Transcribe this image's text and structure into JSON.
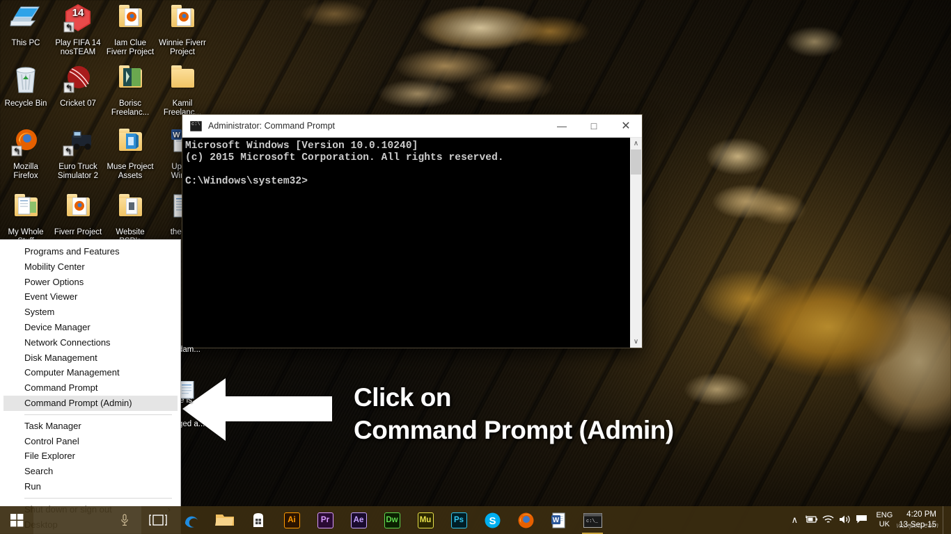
{
  "desktop": {
    "icons": [
      {
        "label": "This PC",
        "art": "monitor",
        "col": 0,
        "row": 0
      },
      {
        "label": "Play FIFA 14\nnosTEAM",
        "art": "fifa",
        "col": 1,
        "row": 0
      },
      {
        "label": "Iam Clue\nFiverr Project",
        "art": "folder-firefox",
        "col": 2,
        "row": 0
      },
      {
        "label": "Winnie Fiverr\nProject",
        "art": "folder-firefox",
        "col": 3,
        "row": 0
      },
      {
        "label": "Recycle Bin",
        "art": "recycle",
        "col": 0,
        "row": 1
      },
      {
        "label": "Cricket 07",
        "art": "cricket",
        "col": 1,
        "row": 1
      },
      {
        "label": "Borisc\nFreelanc...",
        "art": "folder-green",
        "col": 2,
        "row": 1
      },
      {
        "label": "Kamil\nFreelanc...",
        "art": "folder",
        "col": 3,
        "row": 1
      },
      {
        "label": "Mozilla\nFirefox",
        "art": "firefox",
        "col": 0,
        "row": 2
      },
      {
        "label": "Euro Truck\nSimulator 2",
        "art": "truck",
        "col": 1,
        "row": 2
      },
      {
        "label": "Muse Project\nAssets",
        "art": "folder-muse",
        "col": 2,
        "row": 2
      },
      {
        "label": "Upgra\nWindo",
        "art": "word-doc",
        "col": 3,
        "row": 2
      },
      {
        "label": "My Whole\nStuff",
        "art": "folder-docs",
        "col": 0,
        "row": 3
      },
      {
        "label": "Fiverr Project",
        "art": "folder-firefox",
        "col": 1,
        "row": 3
      },
      {
        "label": "Website\nPSD's",
        "art": "folder-ps",
        "col": 2,
        "row": 3
      },
      {
        "label": "the-file",
        "art": "text-doc",
        "col": 3,
        "row": 3
      }
    ],
    "hidden_icon_labels": [
      "dam...",
      "e is",
      "ged a..."
    ]
  },
  "cmd_window": {
    "title": "Administrator: Command Prompt",
    "icon": "cmd-icon",
    "minimize": "—",
    "maximize": "□",
    "close": "✕",
    "scroll_up": "∧",
    "scroll_down": "∨",
    "content": "Microsoft Windows [Version 10.0.10240]\n(c) 2015 Microsoft Corporation. All rights reserved.\n\nC:\\Windows\\system32>"
  },
  "winx_menu": {
    "selected": "Command Prompt (Admin)",
    "groups": [
      {
        "items": [
          "Programs and Features",
          "Mobility Center",
          "Power Options",
          "Event Viewer",
          "System",
          "Device Manager",
          "Network Connections",
          "Disk Management",
          "Computer Management",
          "Command Prompt",
          "Command Prompt (Admin)"
        ]
      },
      {
        "items": [
          "Task Manager",
          "Control Panel",
          "File Explorer",
          "Search",
          "Run"
        ]
      },
      {
        "items": [
          "Shut down or sign out",
          "Desktop"
        ]
      }
    ],
    "submenu_indicator": "›"
  },
  "callout": {
    "line1": "Click on",
    "line2": "Command Prompt (Admin)",
    "arrow_direction": "left",
    "color": "#ffffff"
  },
  "taskbar": {
    "background": "#3a2c10",
    "start_icon": "windows-logo",
    "search_placeholder": "",
    "mic_icon": "microphone-icon",
    "task_view_icon": "task-view-icon",
    "pinned": [
      {
        "name": "edge",
        "glyph": "e",
        "color": "#1f8ce0",
        "kind": "glyph"
      },
      {
        "name": "explorer",
        "glyph": "",
        "color": "#f7c873",
        "kind": "folder"
      },
      {
        "name": "store",
        "glyph": "",
        "color": "#ffffff",
        "kind": "store"
      },
      {
        "name": "illustrator",
        "glyph": "Ai",
        "color": "#ff9a00",
        "kind": "adobe",
        "bg": "#2b1400"
      },
      {
        "name": "premiere",
        "glyph": "Pr",
        "color": "#d99cff",
        "kind": "adobe",
        "bg": "#2a0a33"
      },
      {
        "name": "aftereffects",
        "glyph": "Ae",
        "color": "#c5a3ff",
        "kind": "adobe",
        "bg": "#1a0b2e"
      },
      {
        "name": "dreamweaver",
        "glyph": "Dw",
        "color": "#5fd94f",
        "kind": "adobe",
        "bg": "#0b2000"
      },
      {
        "name": "muse",
        "glyph": "Mu",
        "color": "#e8e24a",
        "kind": "adobe",
        "bg": "#2a2600"
      },
      {
        "name": "photoshop",
        "glyph": "Ps",
        "color": "#31c5f0",
        "kind": "adobe",
        "bg": "#001e26"
      },
      {
        "name": "skype",
        "glyph": "S",
        "color": "#ffffff",
        "kind": "skype"
      },
      {
        "name": "firefox",
        "glyph": "",
        "color": "#e66000",
        "kind": "firefox"
      },
      {
        "name": "word",
        "glyph": "W",
        "color": "#2b579a",
        "kind": "word"
      },
      {
        "name": "command-prompt",
        "glyph": "c:\\_",
        "color": "#dddddd",
        "kind": "cmd",
        "running": true
      }
    ],
    "tray": {
      "show_hidden": "∧",
      "icons": [
        "battery-icon",
        "wifi-icon",
        "volume-icon",
        "action-center-icon"
      ],
      "language_line1": "ENG",
      "language_line2": "UK",
      "time": "4:20 PM",
      "date": "13-Sep-15",
      "watermark": "wsxpcu.com"
    }
  }
}
